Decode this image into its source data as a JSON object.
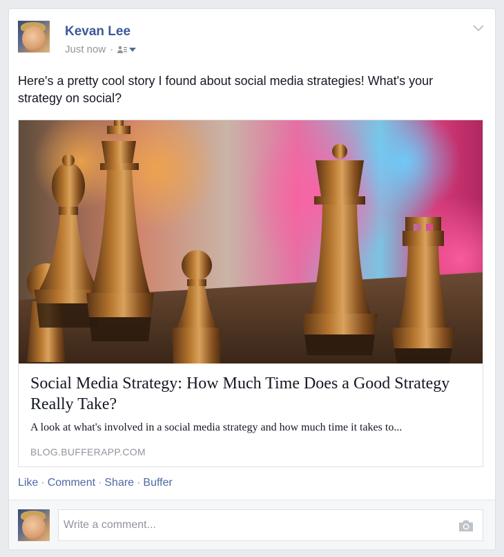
{
  "post": {
    "author": "Kevan Lee",
    "timestamp": "Just now",
    "separator": "·",
    "audience_icon": "friends-audience-icon",
    "text": "Here's a pretty cool story I found about social media strategies! What's your strategy on social?"
  },
  "link": {
    "title": "Social Media Strategy: How Much Time Does a Good Strategy Really Take?",
    "description": "A look at what's involved in a social media strategy and how much time it takes to...",
    "domain": "BLOG.BUFFERAPP.COM"
  },
  "actions": {
    "like": "Like",
    "comment": "Comment",
    "share": "Share",
    "buffer": "Buffer",
    "separator": "·"
  },
  "comment": {
    "placeholder": "Write a comment...",
    "camera_icon": "camera-icon"
  },
  "colors": {
    "link_blue": "#3b5998",
    "action_blue": "#4e69a2",
    "meta_gray": "#90949c"
  }
}
